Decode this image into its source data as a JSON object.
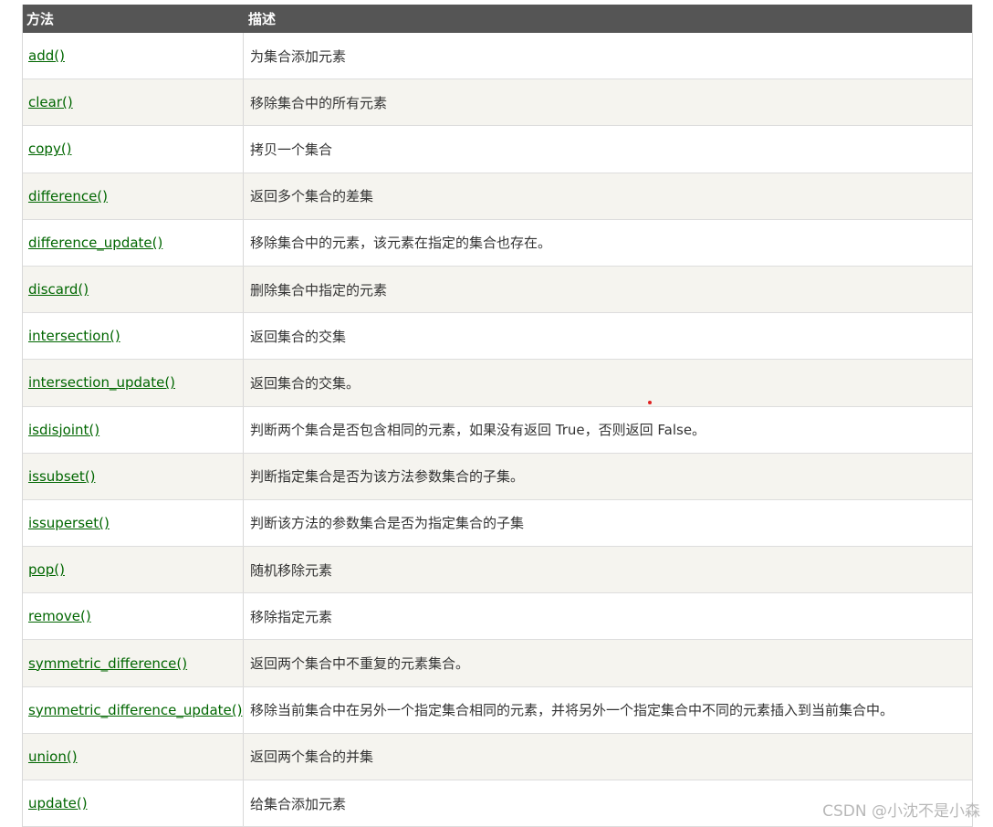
{
  "table": {
    "headers": {
      "method": "方法",
      "description": "描述"
    },
    "rows": [
      {
        "method": "add()",
        "description": "为集合添加元素"
      },
      {
        "method": "clear()",
        "description": "移除集合中的所有元素"
      },
      {
        "method": "copy()",
        "description": "拷贝一个集合"
      },
      {
        "method": "difference()",
        "description": "返回多个集合的差集"
      },
      {
        "method": "difference_update()",
        "description": "移除集合中的元素，该元素在指定的集合也存在。"
      },
      {
        "method": "discard()",
        "description": "删除集合中指定的元素"
      },
      {
        "method": "intersection()",
        "description": "返回集合的交集"
      },
      {
        "method": "intersection_update()",
        "description": "返回集合的交集。"
      },
      {
        "method": "isdisjoint()",
        "description": "判断两个集合是否包含相同的元素，如果没有返回 True，否则返回 False。"
      },
      {
        "method": "issubset()",
        "description": "判断指定集合是否为该方法参数集合的子集。"
      },
      {
        "method": "issuperset()",
        "description": "判断该方法的参数集合是否为指定集合的子集"
      },
      {
        "method": "pop()",
        "description": "随机移除元素"
      },
      {
        "method": "remove()",
        "description": "移除指定元素"
      },
      {
        "method": "symmetric_difference()",
        "description": "返回两个集合中不重复的元素集合。"
      },
      {
        "method": "symmetric_difference_update()",
        "description": "移除当前集合中在另外一个指定集合相同的元素，并将另外一个指定集合中不同的元素插入到当前集合中。"
      },
      {
        "method": "union()",
        "description": "返回两个集合的并集"
      },
      {
        "method": "update()",
        "description": "给集合添加元素"
      }
    ]
  },
  "watermark": "CSDN @小沈不是小森",
  "colors": {
    "header_bg": "#555555",
    "link": "#006600",
    "alt_row_bg": "#f5f4ef",
    "marker_dot": "#e02020"
  }
}
